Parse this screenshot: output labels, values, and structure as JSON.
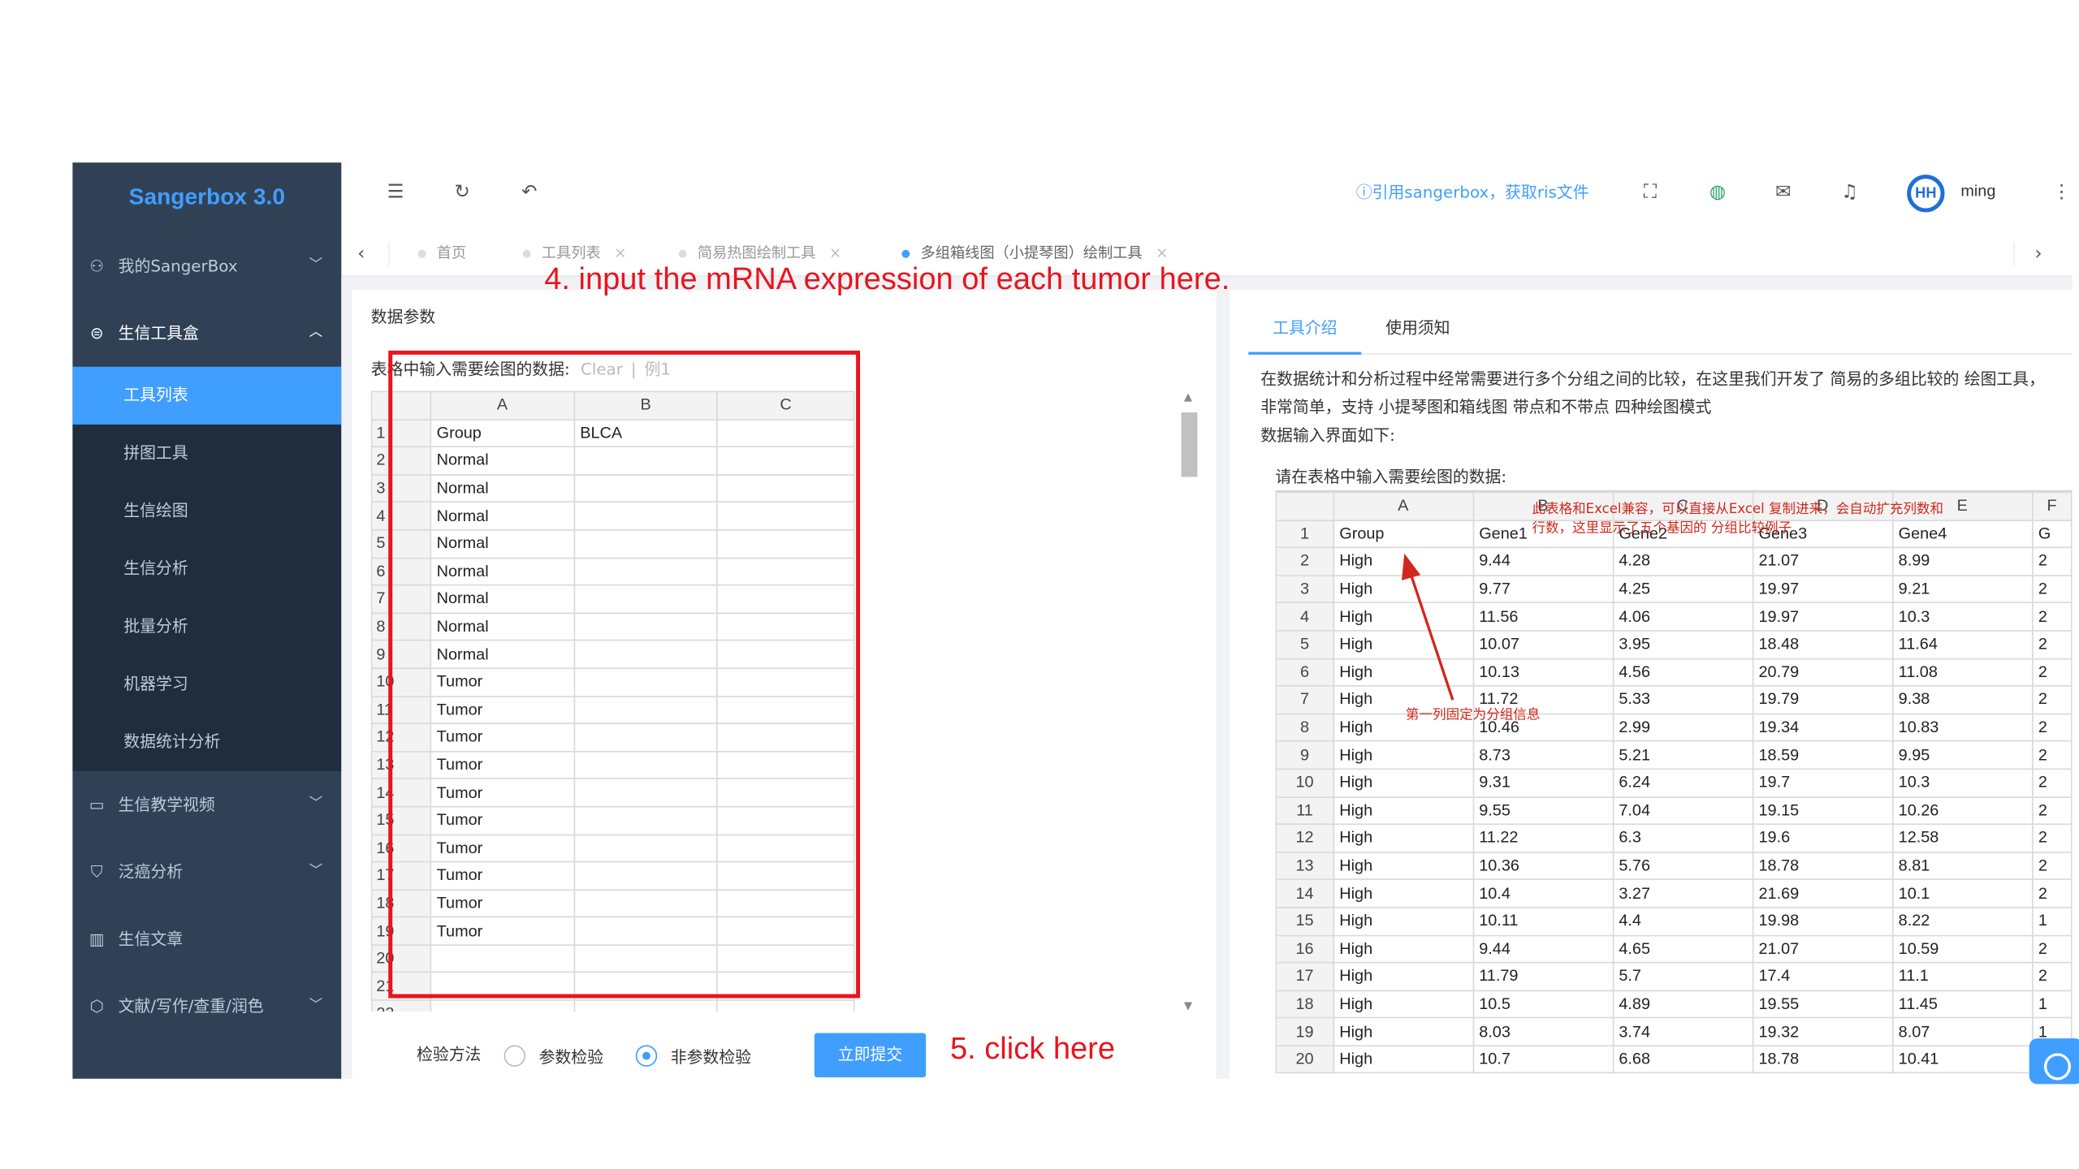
{
  "sidebar": {
    "brand": "Sangerbox 3.0",
    "menu": [
      {
        "label": "我的SangerBox",
        "icon": "user-icon"
      },
      {
        "label": "生信工具盒",
        "icon": "toolbox-icon"
      }
    ],
    "submenu": [
      "工具列表",
      "拼图工具",
      "生信绘图",
      "生信分析",
      "批量分析",
      "机器学习",
      "数据统计分析"
    ],
    "menu_after": [
      {
        "label": "生信教学视频",
        "icon": "video-icon"
      },
      {
        "label": "泛癌分析",
        "icon": "shield-icon"
      },
      {
        "label": "生信文章",
        "icon": "book-icon"
      },
      {
        "label": "文献/写作/查重/润色",
        "icon": "cube-icon"
      }
    ]
  },
  "header": {
    "cite_text": "ⓘ引用sangerbox，获取ris文件",
    "username": "ming",
    "avatar_text": "HH"
  },
  "tabs": [
    "首页",
    "工具列表",
    "简易热图绘制工具",
    "多组箱线图（小提琴图）绘制工具"
  ],
  "left": {
    "section_title": "数据参数",
    "input_hint": "表格中输入需要绘图的数据:",
    "clear_link": "Clear",
    "example_link": "例1",
    "columns": [
      "A",
      "B",
      "C"
    ],
    "rows": [
      [
        "1",
        "Group",
        "BLCA",
        ""
      ],
      [
        "2",
        "Normal",
        "",
        ""
      ],
      [
        "3",
        "Normal",
        "",
        ""
      ],
      [
        "4",
        "Normal",
        "",
        ""
      ],
      [
        "5",
        "Normal",
        "",
        ""
      ],
      [
        "6",
        "Normal",
        "",
        ""
      ],
      [
        "7",
        "Normal",
        "",
        ""
      ],
      [
        "8",
        "Normal",
        "",
        ""
      ],
      [
        "9",
        "Normal",
        "",
        ""
      ],
      [
        "10",
        "Tumor",
        "",
        ""
      ],
      [
        "11",
        "Tumor",
        "",
        ""
      ],
      [
        "12",
        "Tumor",
        "",
        ""
      ],
      [
        "13",
        "Tumor",
        "",
        ""
      ],
      [
        "14",
        "Tumor",
        "",
        ""
      ],
      [
        "15",
        "Tumor",
        "",
        ""
      ],
      [
        "16",
        "Tumor",
        "",
        ""
      ],
      [
        "17",
        "Tumor",
        "",
        ""
      ],
      [
        "18",
        "Tumor",
        "",
        ""
      ],
      [
        "19",
        "Tumor",
        "",
        ""
      ],
      [
        "20",
        "",
        "",
        ""
      ],
      [
        "21",
        "",
        "",
        ""
      ],
      [
        "22",
        "",
        "",
        ""
      ]
    ],
    "method_label": "检验方法",
    "radio_param": "参数检验",
    "radio_nonparam": "非参数检验",
    "submit_label": "立即提交"
  },
  "right": {
    "tab_intro": "工具介绍",
    "tab_notes": "使用须知",
    "intro_text": "在数据统计和分析过程中经常需要进行多个分组之间的比较，在这里我们开发了 简易的多组比较的 绘图工具，非常简单，支持 小提琴图和箱线图 带点和不带点 四种绘图模式",
    "intro_text2": "数据输入界面如下:",
    "example_caption": "请在表格中输入需要绘图的数据:",
    "columns": [
      "A",
      "B",
      "C",
      "D",
      "E",
      "F"
    ],
    "rows": [
      [
        "1",
        "Group",
        "Gene1",
        "Gene2",
        "Gene3",
        "Gene4",
        "G"
      ],
      [
        "2",
        "High",
        "9.44",
        "4.28",
        "21.07",
        "8.99",
        "2"
      ],
      [
        "3",
        "High",
        "9.77",
        "4.25",
        "19.97",
        "9.21",
        "2"
      ],
      [
        "4",
        "High",
        "11.56",
        "4.06",
        "19.97",
        "10.3",
        "2"
      ],
      [
        "5",
        "High",
        "10.07",
        "3.95",
        "18.48",
        "11.64",
        "2"
      ],
      [
        "6",
        "High",
        "10.13",
        "4.56",
        "20.79",
        "11.08",
        "2"
      ],
      [
        "7",
        "High",
        "11.72",
        "5.33",
        "19.79",
        "9.38",
        "2"
      ],
      [
        "8",
        "High",
        "10.46",
        "2.99",
        "19.34",
        "10.83",
        "2"
      ],
      [
        "9",
        "High",
        "8.73",
        "5.21",
        "18.59",
        "9.95",
        "2"
      ],
      [
        "10",
        "High",
        "9.31",
        "6.24",
        "19.7",
        "10.3",
        "2"
      ],
      [
        "11",
        "High",
        "9.55",
        "7.04",
        "19.15",
        "10.26",
        "2"
      ],
      [
        "12",
        "High",
        "11.22",
        "6.3",
        "19.6",
        "12.58",
        "2"
      ],
      [
        "13",
        "High",
        "10.36",
        "5.76",
        "18.78",
        "8.81",
        "2"
      ],
      [
        "14",
        "High",
        "10.4",
        "3.27",
        "21.69",
        "10.1",
        "2"
      ],
      [
        "15",
        "High",
        "10.11",
        "4.4",
        "19.98",
        "8.22",
        "1"
      ],
      [
        "16",
        "High",
        "9.44",
        "4.65",
        "21.07",
        "10.59",
        "2"
      ],
      [
        "17",
        "High",
        "11.79",
        "5.7",
        "17.4",
        "11.1",
        "2"
      ],
      [
        "18",
        "High",
        "10.5",
        "4.89",
        "19.55",
        "11.45",
        "1"
      ],
      [
        "19",
        "High",
        "8.03",
        "3.74",
        "19.32",
        "8.07",
        "1"
      ],
      [
        "20",
        "High",
        "10.7",
        "6.68",
        "18.78",
        "10.41",
        "1"
      ]
    ],
    "note_top": "此表格和Excel兼容，可以直接从Excel 复制进来，会自动扩充列数和行数，这里显示了五个基因的 分组比较例子",
    "note_first_col": "第一列固定为分组信息"
  },
  "annotations": {
    "step4": "4. input the mRNA expression of each tumor here.",
    "step5": "5. click here"
  },
  "colors": {
    "accent": "#409eff",
    "sidebar_bg": "#304156",
    "annotation_red": "#e8141e"
  }
}
